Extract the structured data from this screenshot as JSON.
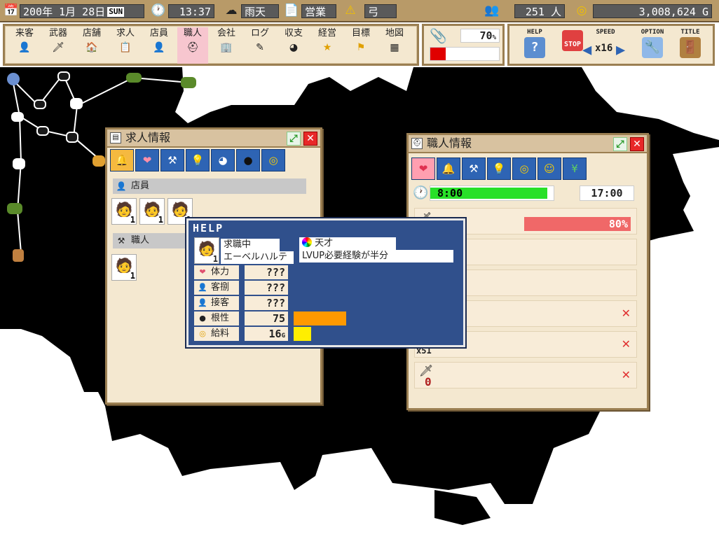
{
  "status_bar": {
    "date": "200年 1月 28日",
    "weekday": "SUN",
    "time": "13:37",
    "weather": "雨天",
    "shop_state": "営業",
    "alert": "弓",
    "population": "251 人",
    "gold": "3,008,624 G"
  },
  "menu": {
    "items": [
      {
        "label": "来客",
        "icon": "visitor-icon"
      },
      {
        "label": "武器",
        "icon": "sword-icon"
      },
      {
        "label": "店舗",
        "icon": "house-icon"
      },
      {
        "label": "求人",
        "icon": "job-listing-icon"
      },
      {
        "label": "店員",
        "icon": "clerk-icon"
      },
      {
        "label": "職人",
        "icon": "craftsman-icon"
      },
      {
        "label": "会社",
        "icon": "company-icon"
      },
      {
        "label": "ログ",
        "icon": "log-icon"
      },
      {
        "label": "収支",
        "icon": "balance-icon"
      },
      {
        "label": "経営",
        "icon": "star-icon"
      },
      {
        "label": "目標",
        "icon": "flag-icon"
      },
      {
        "label": "地図",
        "icon": "map-icon"
      }
    ]
  },
  "capacity": {
    "value": "70",
    "unit": "%",
    "bar_fill": 0.22,
    "bar_color": "#e00000"
  },
  "controls": {
    "help": "HELP",
    "speed": "SPEED",
    "speed_value": "x16",
    "stop": "STOP",
    "option": "OPTION",
    "title": "TITLE"
  },
  "job_window": {
    "title": "求人情報",
    "section_clerk": "店員",
    "section_craftsman": "職人",
    "clerk_counts": [
      "1",
      "1",
      "1"
    ],
    "craftsman_counts": [
      "1"
    ]
  },
  "craftsman_window": {
    "title": "職人情報",
    "time_start": "8:00",
    "time_end": "17:00",
    "work_progress": 0.95,
    "percent": "80%",
    "count_a": "x51",
    "count_b": "0"
  },
  "help_popup": {
    "title": "HELP",
    "status": "求職中",
    "name": "エーベルハルテ",
    "trait": "天才",
    "trait_desc": "LVUP必要経験が半分",
    "portrait_count": "1",
    "stats": [
      {
        "label": "体力",
        "value": "???",
        "bar": 0,
        "color": "#ff9900"
      },
      {
        "label": "客捌",
        "value": "???",
        "bar": 0,
        "color": "#ff9900"
      },
      {
        "label": "接客",
        "value": "???",
        "bar": 0,
        "color": "#ff9900"
      },
      {
        "label": "根性",
        "value": "75",
        "bar": 0.75,
        "color": "#ff9900"
      },
      {
        "label": "給料",
        "value": "16",
        "unit": "G",
        "bar": 0.25,
        "color": "#ffee00"
      }
    ]
  },
  "map_nodes": [
    "1",
    "2",
    "3",
    "4",
    "5",
    "6",
    "7",
    "8",
    "9",
    "10",
    "11",
    "12"
  ],
  "colors": {
    "frame": "#9b7f52",
    "panel": "#f4e8d0",
    "help_bg": "#30508c",
    "tab": "#2e64b4"
  }
}
